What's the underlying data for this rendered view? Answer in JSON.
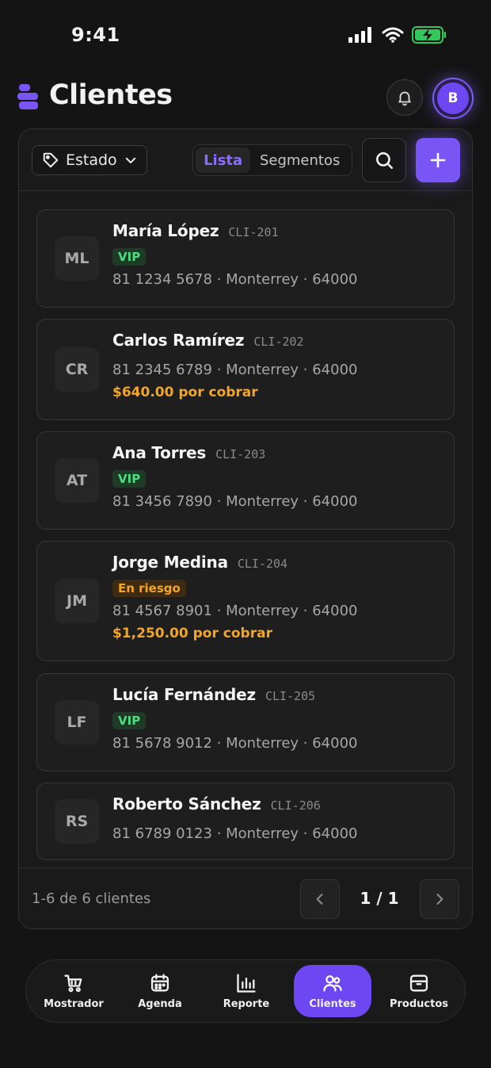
{
  "status": {
    "time": "9:41"
  },
  "header": {
    "title": "Clientes",
    "avatar_initial": "B"
  },
  "colors": {
    "accent": "#7a55f6",
    "vip": "#4ade80",
    "warning": "#f5a524",
    "background": "#141414"
  },
  "toolbar": {
    "filter_label": "Estado",
    "tabs": [
      {
        "label": "Lista",
        "active": true
      },
      {
        "label": "Segmentos",
        "active": false
      }
    ],
    "icons": {
      "filter": "tag-icon",
      "search": "search-icon",
      "add": "plus-icon"
    }
  },
  "clients": [
    {
      "initials": "ML",
      "name": "María López",
      "code": "CLI-201",
      "badge": "VIP",
      "badge_type": "vip",
      "phone": "81 1234 5678",
      "city": "Monterrey",
      "zip": "64000",
      "debt": ""
    },
    {
      "initials": "CR",
      "name": "Carlos Ramírez",
      "code": "CLI-202",
      "badge": "",
      "badge_type": "",
      "phone": "81 2345 6789",
      "city": "Monterrey",
      "zip": "64000",
      "debt": "$640.00 por cobrar"
    },
    {
      "initials": "AT",
      "name": "Ana Torres",
      "code": "CLI-203",
      "badge": "VIP",
      "badge_type": "vip",
      "phone": "81 3456 7890",
      "city": "Monterrey",
      "zip": "64000",
      "debt": ""
    },
    {
      "initials": "JM",
      "name": "Jorge Medina",
      "code": "CLI-204",
      "badge": "En riesgo",
      "badge_type": "risk",
      "phone": "81 4567 8901",
      "city": "Monterrey",
      "zip": "64000",
      "debt": "$1,250.00 por cobrar"
    },
    {
      "initials": "LF",
      "name": "Lucía Fernández",
      "code": "CLI-205",
      "badge": "VIP",
      "badge_type": "vip",
      "phone": "81 5678 9012",
      "city": "Monterrey",
      "zip": "64000",
      "debt": ""
    },
    {
      "initials": "RS",
      "name": "Roberto Sánchez",
      "code": "CLI-206",
      "badge": "",
      "badge_type": "",
      "phone": "81 6789 0123",
      "city": "Monterrey",
      "zip": "64000",
      "debt": ""
    }
  ],
  "pagination": {
    "summary": "1-6 de 6 clientes",
    "page": "1 / 1"
  },
  "tabbar": [
    {
      "label": "Mostrador",
      "icon": "cart-icon",
      "active": false
    },
    {
      "label": "Agenda",
      "icon": "calendar-icon",
      "active": false
    },
    {
      "label": "Reporte",
      "icon": "bar-chart-icon",
      "active": false
    },
    {
      "label": "Clientes",
      "icon": "users-icon",
      "active": true
    },
    {
      "label": "Productos",
      "icon": "box-icon",
      "active": false
    }
  ]
}
